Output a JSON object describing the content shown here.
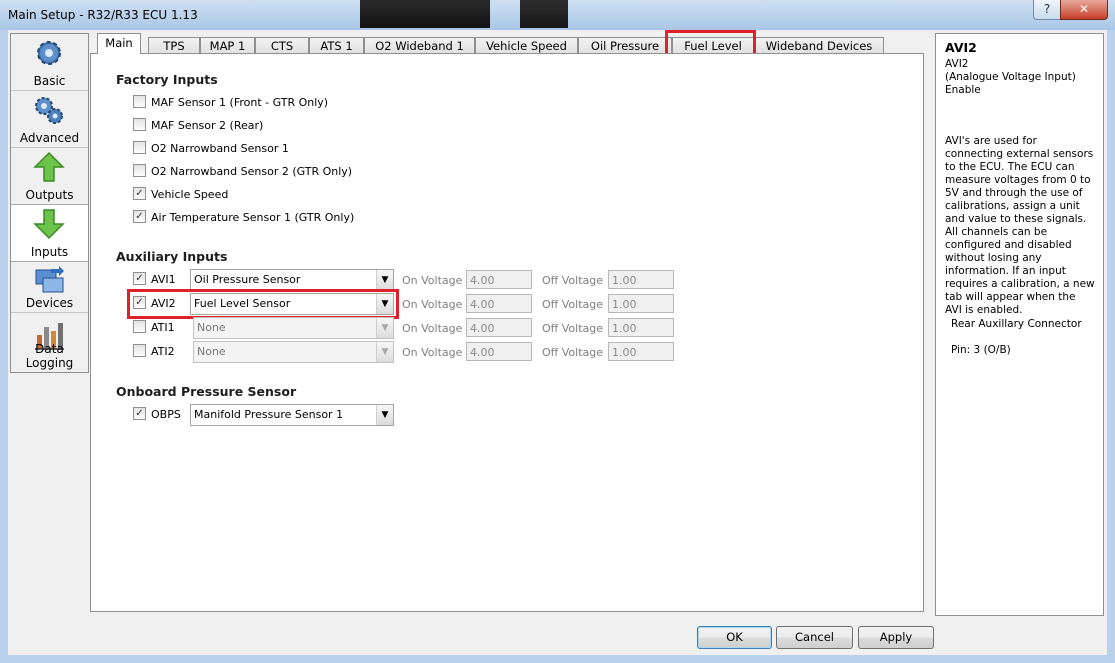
{
  "window": {
    "title": "Main Setup - R32/R33 ECU 1.13",
    "help_label": "?",
    "close_label": "✕"
  },
  "sidebar": {
    "items": [
      {
        "label": "Basic",
        "icon": "gear-icon"
      },
      {
        "label": "Advanced",
        "icon": "gears-icon"
      },
      {
        "label": "Outputs",
        "icon": "up-arrow-icon"
      },
      {
        "label": "Inputs",
        "icon": "down-arrow-icon"
      },
      {
        "label": "Devices",
        "icon": "devices-icon"
      },
      {
        "label": "Data Logging",
        "icon": "data-logging-icon"
      }
    ],
    "active": "Inputs"
  },
  "tabs": [
    {
      "label": "Main"
    },
    {
      "label": "TPS"
    },
    {
      "label": "MAP 1"
    },
    {
      "label": "CTS"
    },
    {
      "label": "ATS 1"
    },
    {
      "label": "O2 Wideband 1"
    },
    {
      "label": "Vehicle Speed"
    },
    {
      "label": "Oil Pressure"
    },
    {
      "label": "Fuel Level"
    },
    {
      "label": "Wideband Devices"
    }
  ],
  "selected_tab": "Main",
  "factory": {
    "heading": "Factory Inputs",
    "items": [
      {
        "label": "MAF Sensor 1 (Front - GTR Only)",
        "checked": false
      },
      {
        "label": "MAF Sensor 2 (Rear)",
        "checked": false
      },
      {
        "label": "O2 Narrowband Sensor 1",
        "checked": false
      },
      {
        "label": "O2 Narrowband Sensor 2 (GTR Only)",
        "checked": false
      },
      {
        "label": "Vehicle Speed",
        "checked": true
      },
      {
        "label": "Air Temperature Sensor 1 (GTR  Only)",
        "checked": true
      }
    ]
  },
  "auxiliary": {
    "heading": "Auxiliary Inputs",
    "on_label": "On Voltage",
    "off_label": "Off Voltage",
    "rows": [
      {
        "name": "AVI1",
        "checked": true,
        "sensor": "Oil Pressure Sensor",
        "on": "4.00",
        "off": "1.00"
      },
      {
        "name": "AVI2",
        "checked": true,
        "sensor": "Fuel Level Sensor",
        "on": "4.00",
        "off": "1.00"
      },
      {
        "name": "ATI1",
        "checked": false,
        "sensor": "None",
        "on": "4.00",
        "off": "1.00"
      },
      {
        "name": "ATI2",
        "checked": false,
        "sensor": "None",
        "on": "4.00",
        "off": "1.00"
      }
    ]
  },
  "onboard": {
    "heading": "Onboard Pressure Sensor",
    "name": "OBPS",
    "checked": true,
    "sensor": "Manifold Pressure Sensor 1"
  },
  "info": {
    "title": "AVI2",
    "sub": [
      "AVI2",
      "(Analogue Voltage Input)",
      "Enable"
    ],
    "description": "AVI's are used for connecting external sensors to the ECU. The ECU can measure voltages from 0 to 5V and through the use of calibrations, assign a unit and value to these signals. All channels can be configured and disabled without losing any information. If an input requires a calibration, a new tab will appear when the AVI is enabled.",
    "connector": "Rear Auxillary Connector",
    "pin": "Pin: 3 (O/B)"
  },
  "buttons": {
    "ok": "OK",
    "cancel": "Cancel",
    "apply": "Apply"
  },
  "colors": {
    "highlight": "#e0202a",
    "titlebar": "#b9d1ea",
    "check": "#333333"
  }
}
